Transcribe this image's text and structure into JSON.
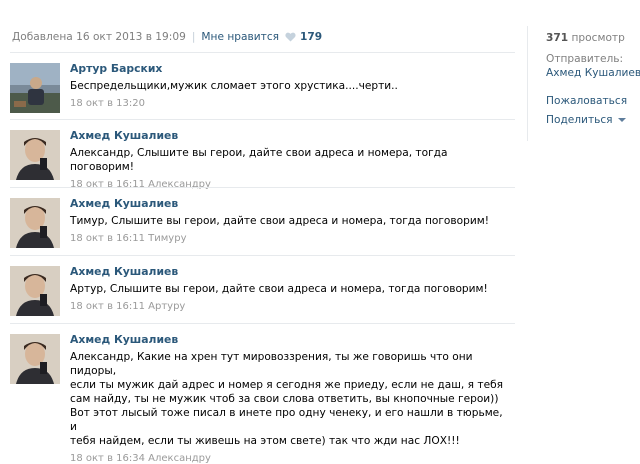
{
  "post_header": {
    "added": "Добавлена 16 окт 2013 в 19:09",
    "like_label": "Мне нравится",
    "like_count": "179"
  },
  "sidebar": {
    "views_count": "371",
    "views_label": "просмотр",
    "sender_label": "Отправитель:",
    "sender_name": "Ахмед Кушалиев",
    "report": "Пожаловаться",
    "share": "Поделиться"
  },
  "comments": [
    {
      "author": "Артур Барских",
      "text": "Беспредельщики,мужик сломает этого хрустика....черти..",
      "date": "18 окт в 13:20",
      "reply_to": ""
    },
    {
      "author": "Ахмед Кушалиев",
      "text": "Александр, Слышите вы герои, дайте свои адреса и номера, тогда поговорим!",
      "date": "18 окт в 16:11",
      "reply_to": "Александру"
    },
    {
      "author": "Ахмед Кушалиев",
      "text": "Тимур, Слышите вы герои, дайте свои адреса и номера, тогда поговорим!",
      "date": "18 окт в 16:11",
      "reply_to": "Тимуру"
    },
    {
      "author": "Ахмед Кушалиев",
      "text": "Артур, Слышите вы герои, дайте свои адреса и номера, тогда поговорим!",
      "date": "18 окт в 16:11",
      "reply_to": "Артуру"
    },
    {
      "author": "Ахмед Кушалиев",
      "text": "Александр, Какие на хрен тут мировоззрения, ты же говоришь что они пидоры,\nесли ты мужик дай адрес и номер я сегодня же приеду, если не даш, я тебя\nсам найду, ты не мужик чтоб за свои слова ответить, вы кнопочные герои))\nВот этот лысый тоже писал в инете про одну ченеку, и его нашли в тюрьме, и\nтебя найдем, если ты живешь на этом свете) так что жди нас ЛОХ!!!",
      "date": "18 окт в 16:34",
      "reply_to": "Александру"
    }
  ],
  "colors": {
    "link": "#2b587a",
    "muted": "#7f7f7f",
    "divider": "#e7eaed"
  },
  "icons": {
    "like": "heart-icon",
    "share_menu": "caret-down-icon"
  }
}
